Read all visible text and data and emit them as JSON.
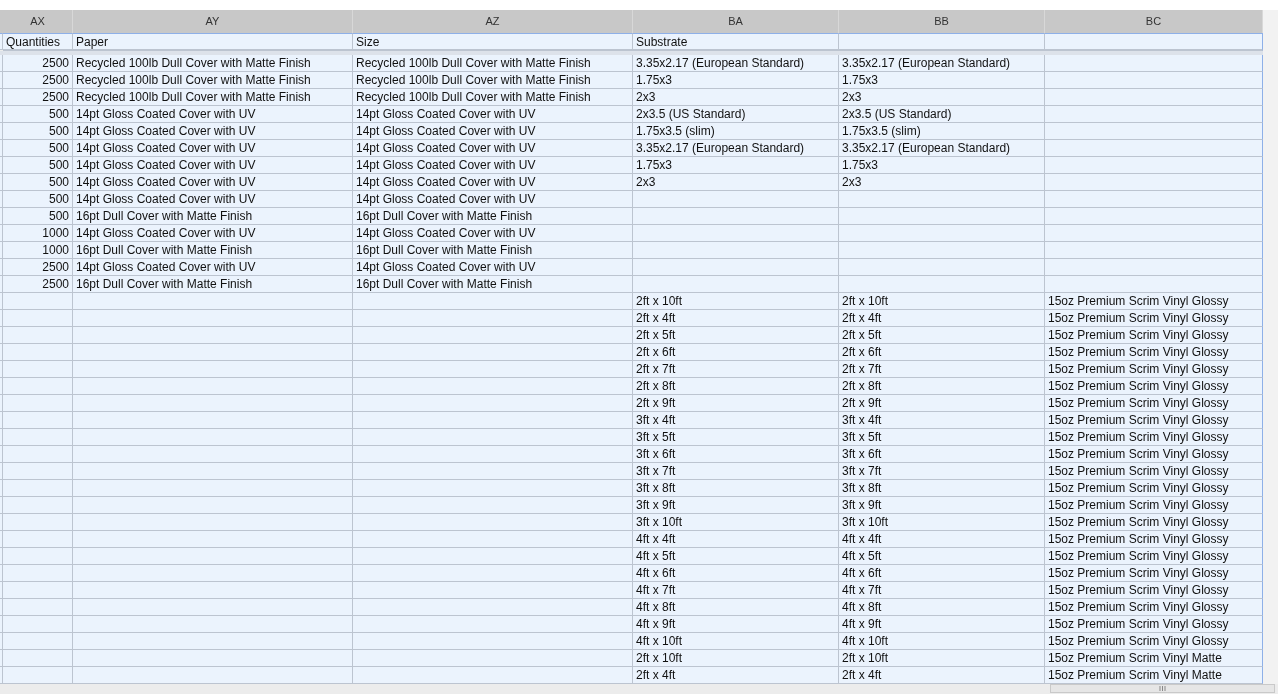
{
  "column_letters": [
    "AX",
    "AY",
    "AZ",
    "BA",
    "BB",
    "BC"
  ],
  "header_row": {
    "AX": "Quantities",
    "AY": "Paper",
    "AZ": "Size",
    "BA": "Substrate"
  },
  "rows": [
    {
      "AX": "2500",
      "AY": "Recycled 100lb Dull Cover with Matte Finish",
      "AZ": "Recycled 100lb Dull Cover with Matte Finish",
      "BA": "3.35x2.17 (European Standard)",
      "BB": "3.35x2.17 (European Standard)"
    },
    {
      "AX": "2500",
      "AY": "Recycled 100lb Dull Cover with Matte Finish",
      "AZ": "Recycled 100lb Dull Cover with Matte Finish",
      "BA": "1.75x3",
      "BB": "1.75x3"
    },
    {
      "AX": "2500",
      "AY": "Recycled 100lb Dull Cover with Matte Finish",
      "AZ": "Recycled 100lb Dull Cover with Matte Finish",
      "BA": "2x3",
      "BB": "2x3"
    },
    {
      "AX": "500",
      "AY": "14pt Gloss Coated Cover with UV",
      "AZ": "14pt Gloss Coated Cover with UV",
      "BA": "2x3.5 (US Standard)",
      "BB": "2x3.5 (US Standard)"
    },
    {
      "AX": "500",
      "AY": "14pt Gloss Coated Cover with UV",
      "AZ": "14pt Gloss Coated Cover with UV",
      "BA": "1.75x3.5 (slim)",
      "BB": "1.75x3.5 (slim)"
    },
    {
      "AX": "500",
      "AY": "14pt Gloss Coated Cover with UV",
      "AZ": "14pt Gloss Coated Cover with UV",
      "BA": "3.35x2.17 (European Standard)",
      "BB": "3.35x2.17 (European Standard)"
    },
    {
      "AX": "500",
      "AY": "14pt Gloss Coated Cover with UV",
      "AZ": "14pt Gloss Coated Cover with UV",
      "BA": "1.75x3",
      "BB": "1.75x3"
    },
    {
      "AX": "500",
      "AY": "14pt Gloss Coated Cover with UV",
      "AZ": "14pt Gloss Coated Cover with UV",
      "BA": "2x3",
      "BB": "2x3"
    },
    {
      "AX": "500",
      "AY": "14pt Gloss Coated Cover with UV",
      "AZ": "14pt Gloss Coated Cover with UV"
    },
    {
      "AX": "500",
      "AY": "16pt Dull Cover with Matte Finish",
      "AZ": "16pt Dull Cover with Matte Finish"
    },
    {
      "AX": "1000",
      "AY": "14pt Gloss Coated Cover with UV",
      "AZ": "14pt Gloss Coated Cover with UV"
    },
    {
      "AX": "1000",
      "AY": "16pt Dull Cover with Matte Finish",
      "AZ": "16pt Dull Cover with Matte Finish"
    },
    {
      "AX": "2500",
      "AY": "14pt Gloss Coated Cover with UV",
      "AZ": "14pt Gloss Coated Cover with UV"
    },
    {
      "AX": "2500",
      "AY": "16pt Dull Cover with Matte Finish",
      "AZ": "16pt Dull Cover with Matte Finish"
    },
    {
      "BA": "2ft x 10ft",
      "BB": "2ft x 10ft",
      "BC": "15oz Premium Scrim Vinyl Glossy"
    },
    {
      "BA": "2ft x 4ft",
      "BB": "2ft x 4ft",
      "BC": "15oz Premium Scrim Vinyl Glossy"
    },
    {
      "BA": "2ft x 5ft",
      "BB": "2ft x 5ft",
      "BC": "15oz Premium Scrim Vinyl Glossy"
    },
    {
      "BA": "2ft x 6ft",
      "BB": "2ft x 6ft",
      "BC": "15oz Premium Scrim Vinyl Glossy"
    },
    {
      "BA": "2ft x 7ft",
      "BB": "2ft x 7ft",
      "BC": "15oz Premium Scrim Vinyl Glossy"
    },
    {
      "BA": "2ft x 8ft",
      "BB": "2ft x 8ft",
      "BC": "15oz Premium Scrim Vinyl Glossy"
    },
    {
      "BA": "2ft x 9ft",
      "BB": "2ft x 9ft",
      "BC": "15oz Premium Scrim Vinyl Glossy"
    },
    {
      "BA": "3ft x 4ft",
      "BB": "3ft x 4ft",
      "BC": "15oz Premium Scrim Vinyl Glossy"
    },
    {
      "BA": "3ft x 5ft",
      "BB": "3ft x 5ft",
      "BC": "15oz Premium Scrim Vinyl Glossy"
    },
    {
      "BA": "3ft x 6ft",
      "BB": "3ft x 6ft",
      "BC": "15oz Premium Scrim Vinyl Glossy"
    },
    {
      "BA": "3ft x 7ft",
      "BB": "3ft x 7ft",
      "BC": "15oz Premium Scrim Vinyl Glossy"
    },
    {
      "BA": "3ft x 8ft",
      "BB": "3ft x 8ft",
      "BC": "15oz Premium Scrim Vinyl Glossy"
    },
    {
      "BA": "3ft x 9ft",
      "BB": "3ft x 9ft",
      "BC": "15oz Premium Scrim Vinyl Glossy"
    },
    {
      "BA": "3ft x 10ft",
      "BB": "3ft x 10ft",
      "BC": "15oz Premium Scrim Vinyl Glossy"
    },
    {
      "BA": "4ft x 4ft",
      "BB": "4ft x 4ft",
      "BC": "15oz Premium Scrim Vinyl Glossy"
    },
    {
      "BA": "4ft x 5ft",
      "BB": "4ft x 5ft",
      "BC": "15oz Premium Scrim Vinyl Glossy"
    },
    {
      "BA": "4ft x 6ft",
      "BB": "4ft x 6ft",
      "BC": "15oz Premium Scrim Vinyl Glossy"
    },
    {
      "BA": "4ft x 7ft",
      "BB": "4ft x 7ft",
      "BC": "15oz Premium Scrim Vinyl Glossy"
    },
    {
      "BA": "4ft x 8ft",
      "BB": "4ft x 8ft",
      "BC": "15oz Premium Scrim Vinyl Glossy"
    },
    {
      "BA": "4ft x 9ft",
      "BB": "4ft x 9ft",
      "BC": "15oz Premium Scrim Vinyl Glossy"
    },
    {
      "BA": "4ft x 10ft",
      "BB": "4ft x 10ft",
      "BC": "15oz Premium Scrim Vinyl Glossy"
    },
    {
      "BA": "2ft x 10ft",
      "BB": "2ft x 10ft",
      "BC": "15oz Premium Scrim Vinyl Matte"
    },
    {
      "BA": "2ft x 4ft",
      "BB": "2ft x 4ft",
      "BC": "15oz Premium Scrim Vinyl Matte"
    }
  ]
}
